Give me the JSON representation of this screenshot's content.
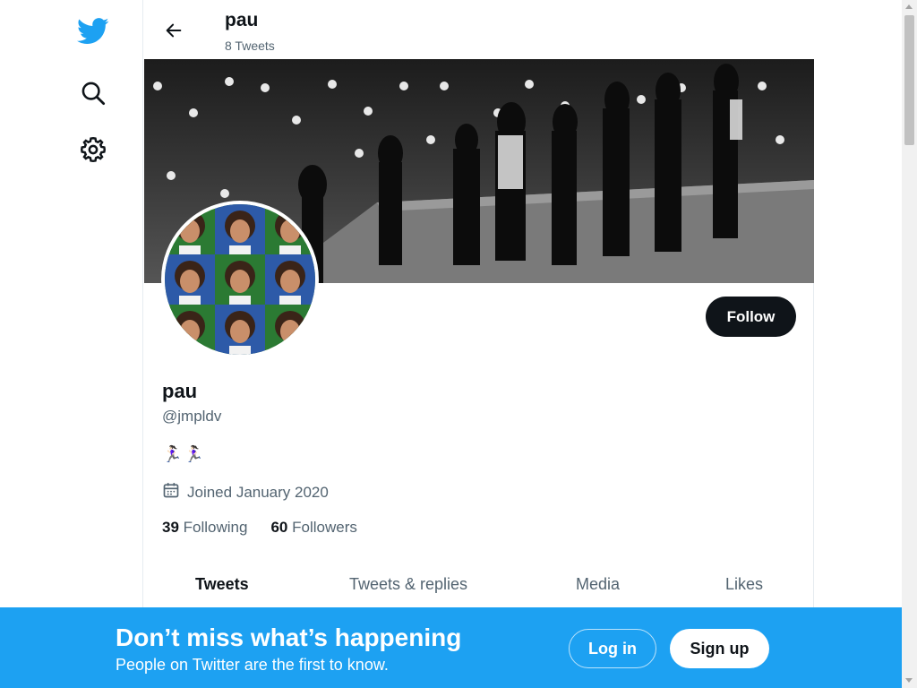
{
  "nav": {
    "icons": [
      "twitter-bird-icon",
      "search-icon",
      "gear-icon"
    ]
  },
  "header": {
    "back_icon": "arrow-left-icon",
    "name": "pau",
    "tweet_count": "8 Tweets"
  },
  "profile": {
    "name": "pau",
    "handle": "@jmpldv",
    "bio": "🏃🏻‍♀️🏃🏻‍♀️",
    "joined": "Joined January 2020",
    "following_count": "39",
    "following_label": "Following",
    "followers_count": "60",
    "followers_label": "Followers",
    "follow_label": "Follow"
  },
  "tabs": [
    {
      "label": "Tweets",
      "active": true
    },
    {
      "label": "Tweets & replies",
      "active": false
    },
    {
      "label": "Media",
      "active": false
    },
    {
      "label": "Likes",
      "active": false
    }
  ],
  "bottom_banner": {
    "title": "Don’t miss what’s happening",
    "subtitle": "People on Twitter are the first to know.",
    "login_label": "Log in",
    "signup_label": "Sign up"
  },
  "colors": {
    "accent": "#1da1f2",
    "text": "#0f1419",
    "secondary": "#536471"
  }
}
